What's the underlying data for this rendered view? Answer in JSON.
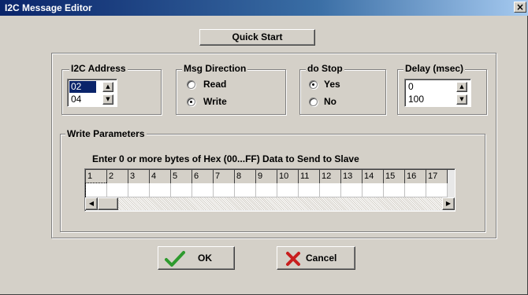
{
  "window": {
    "title": "I2C Message Editor",
    "close_glyph": "×"
  },
  "quick_start_label": "Quick Start",
  "i2c_address": {
    "title": "I2C Address",
    "value1": "02",
    "value2": "04"
  },
  "msg_direction": {
    "title": "Msg Direction",
    "options": [
      "Read",
      "Write"
    ],
    "selected": "Write"
  },
  "do_stop": {
    "title": "do Stop",
    "options": [
      "Yes",
      "No"
    ],
    "selected": "Yes"
  },
  "delay": {
    "title": "Delay (msec)",
    "value1": "0",
    "value2": "100"
  },
  "write_params": {
    "title": "Write Parameters",
    "instruction": "Enter 0 or more bytes of Hex (00...FF) Data to Send to Slave",
    "columns": [
      "1",
      "2",
      "3",
      "4",
      "5",
      "6",
      "7",
      "8",
      "9",
      "10",
      "11",
      "12",
      "13",
      "14",
      "15",
      "16",
      "17"
    ]
  },
  "buttons": {
    "ok_label": "OK",
    "cancel_label": "Cancel"
  },
  "icons": {
    "ok": "checkmark-icon",
    "ok_color": "#2e9a2e",
    "cancel": "x-icon",
    "cancel_color": "#c81e1e",
    "spin_up": "▲",
    "spin_down": "▼",
    "scroll_left": "◀",
    "scroll_right": "▶"
  },
  "colors": {
    "title_bar": "#0a246a",
    "selection": "#0a246a",
    "dialog_bg": "#d4d0c8"
  }
}
